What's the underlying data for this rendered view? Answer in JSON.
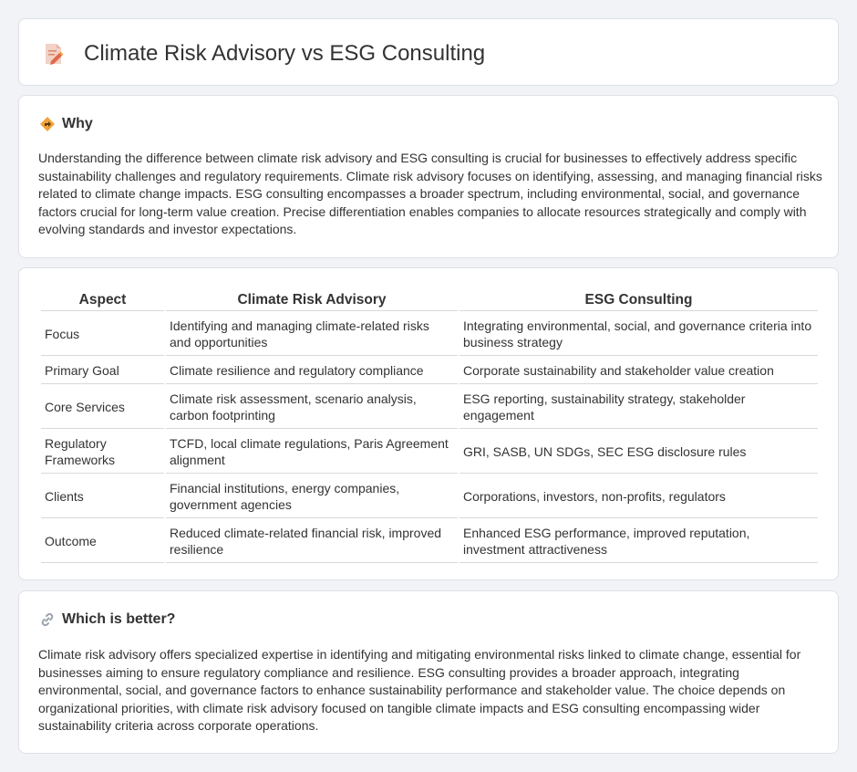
{
  "header": {
    "title": "Climate Risk Advisory vs ESG Consulting",
    "icon": "document-pencil-icon"
  },
  "why": {
    "heading": "Why",
    "icon": "diamond-arrow-icon",
    "text": "Understanding the difference between climate risk advisory and ESG consulting is crucial for businesses to effectively address specific sustainability challenges and regulatory requirements. Climate risk advisory focuses on identifying, assessing, and managing financial risks related to climate change impacts. ESG consulting encompasses a broader spectrum, including environmental, social, and governance factors crucial for long-term value creation. Precise differentiation enables companies to allocate resources strategically and comply with evolving standards and investor expectations."
  },
  "comparison": {
    "headers": [
      "Aspect",
      "Climate Risk Advisory",
      "ESG Consulting"
    ],
    "rows": [
      [
        "Focus",
        "Identifying and managing climate-related risks and opportunities",
        "Integrating environmental, social, and governance criteria into business strategy"
      ],
      [
        "Primary Goal",
        "Climate resilience and regulatory compliance",
        "Corporate sustainability and stakeholder value creation"
      ],
      [
        "Core Services",
        "Climate risk assessment, scenario analysis, carbon footprinting",
        "ESG reporting, sustainability strategy, stakeholder engagement"
      ],
      [
        "Regulatory Frameworks",
        "TCFD, local climate regulations, Paris Agreement alignment",
        "GRI, SASB, UN SDGs, SEC ESG disclosure rules"
      ],
      [
        "Clients",
        "Financial institutions, energy companies, government agencies",
        "Corporations, investors, non-profits, regulators"
      ],
      [
        "Outcome",
        "Reduced climate-related financial risk, improved resilience",
        "Enhanced ESG performance, improved reputation, investment attractiveness"
      ]
    ]
  },
  "better": {
    "heading": "Which is better?",
    "icon": "link-icon",
    "text": "Climate risk advisory offers specialized expertise in identifying and mitigating environmental risks linked to climate change, essential for businesses aiming to ensure regulatory compliance and resilience. ESG consulting provides a broader approach, integrating environmental, social, and governance factors to enhance sustainability performance and stakeholder value. The choice depends on organizational priorities, with climate risk advisory focused on tangible climate impacts and ESG consulting encompassing wider sustainability criteria across corporate operations."
  }
}
